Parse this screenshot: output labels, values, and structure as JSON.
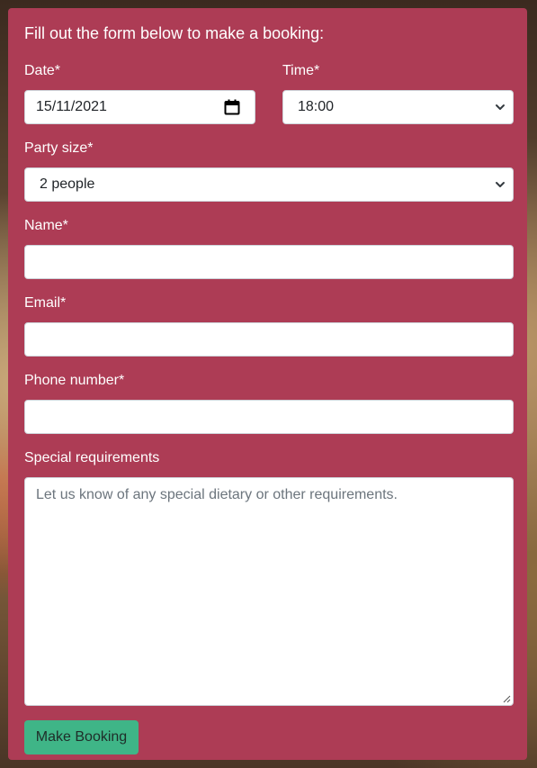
{
  "form": {
    "intro": "Fill out the form below to make a booking:",
    "date": {
      "label": "Date*",
      "value": "15/11/2021"
    },
    "time": {
      "label": "Time*",
      "value": "18:00"
    },
    "party_size": {
      "label": "Party size*",
      "value": "2 people"
    },
    "name": {
      "label": "Name*",
      "value": ""
    },
    "email": {
      "label": "Email*",
      "value": ""
    },
    "phone": {
      "label": "Phone number*",
      "value": ""
    },
    "special": {
      "label": "Special requirements",
      "placeholder": "Let us know of any special dietary or other requirements."
    },
    "submit_label": "Make Booking"
  },
  "colors": {
    "card": "#ad3c55",
    "button": "#3fb587"
  },
  "icons": [
    "calendar-icon",
    "chevron-down-icon",
    "resize-grip-icon"
  ]
}
